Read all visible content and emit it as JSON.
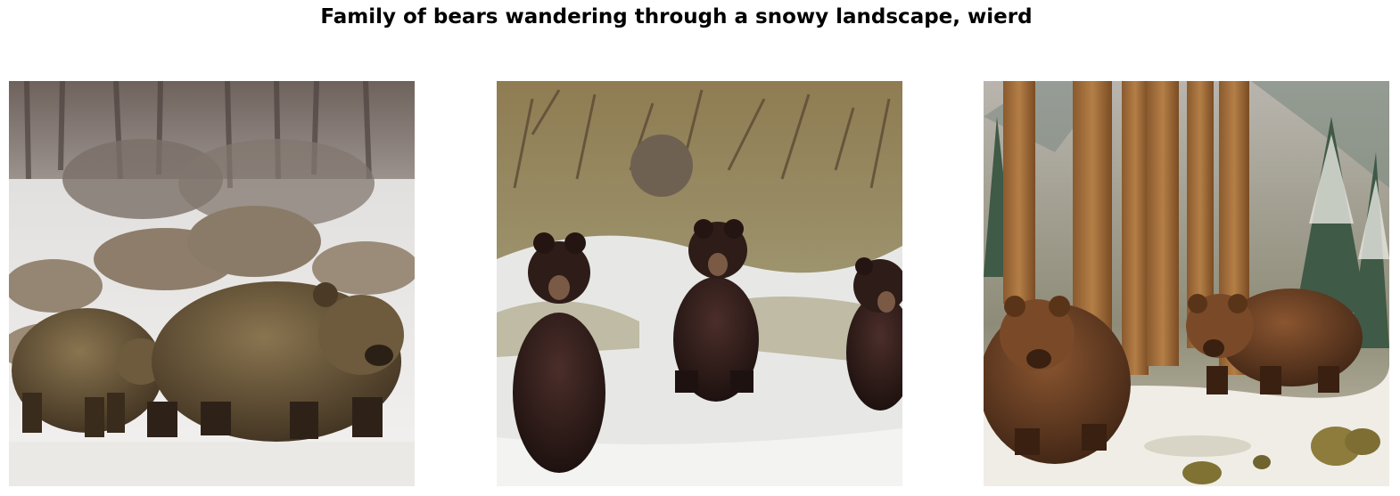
{
  "figure": {
    "title": "Family of bears wandering through a snowy landscape, wierd"
  },
  "panels": [
    {
      "scene": "grizzly-bears-snowy-meadow",
      "bear_color": "#5e4a2c"
    },
    {
      "scene": "black-bears-snowy-field",
      "bear_color": "#2a1a16"
    },
    {
      "scene": "brown-bears-painted-forest",
      "bear_color": "#6a3f22"
    }
  ]
}
